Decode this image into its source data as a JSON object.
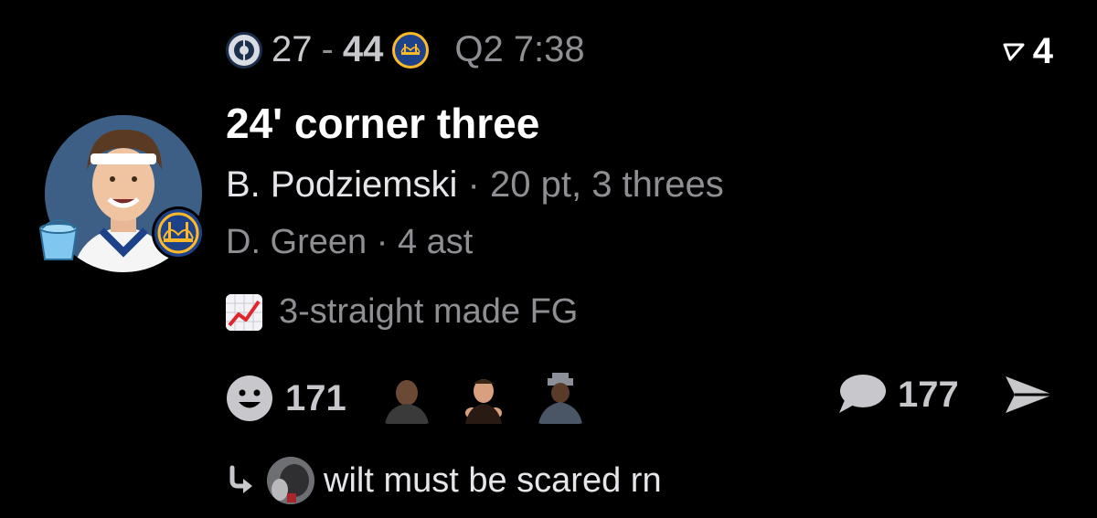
{
  "header": {
    "away_score": "27",
    "dash": "-",
    "home_score": "44",
    "clock": "Q2 7:38",
    "reposts": "4",
    "away_logo": "opponent-logo-icon",
    "home_logo": "warriors-logo-icon"
  },
  "play": {
    "title": "24' corner three",
    "scorer": "B. Podziemski",
    "separator": "·",
    "scorer_stats": "20 pt, 3 threes",
    "assist": "D. Green · 4 ast",
    "streak": "3-straight made FG"
  },
  "reactions": {
    "count": "171",
    "reactors": [
      "reactor-avatar-1",
      "reactor-avatar-2",
      "reactor-avatar-3"
    ],
    "comments": "177"
  },
  "reply": {
    "text": "wilt must be scared rn"
  },
  "colors": {
    "background": "#000000",
    "muted": "#8e8e93",
    "warriors_blue": "#1d428a",
    "warriors_gold": "#fdb927"
  }
}
